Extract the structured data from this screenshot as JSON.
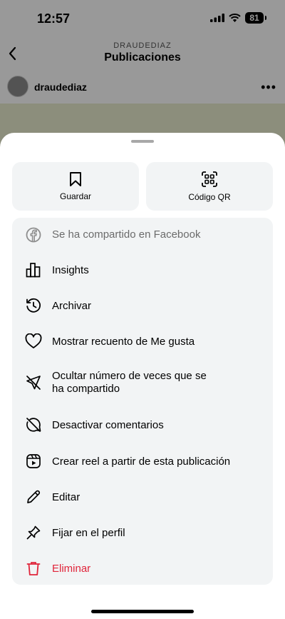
{
  "status_bar": {
    "time": "12:57",
    "battery": "81"
  },
  "nav": {
    "subtitle": "DRAUDEDIAZ",
    "title": "Publicaciones"
  },
  "post": {
    "username": "draudediaz"
  },
  "sheet": {
    "top_actions": [
      {
        "label": "Guardar",
        "icon": "bookmark-icon"
      },
      {
        "label": "Código QR",
        "icon": "qr-code-icon"
      }
    ],
    "menu": [
      {
        "label": "Se ha compartido en Facebook",
        "icon": "facebook-icon"
      },
      {
        "label": "Insights",
        "icon": "bar-chart-icon"
      },
      {
        "label": "Archivar",
        "icon": "archive-history-icon"
      },
      {
        "label": "Mostrar recuento de Me gusta",
        "icon": "heart-icon"
      },
      {
        "label_line1": "Ocultar número de veces que se",
        "label_line2": "ha compartido",
        "icon": "send-off-icon"
      },
      {
        "label": "Desactivar comentarios",
        "icon": "comment-off-icon"
      },
      {
        "label": "Crear reel a partir de esta publicación",
        "icon": "reel-icon"
      },
      {
        "label": "Editar",
        "icon": "pencil-icon"
      },
      {
        "label": "Fijar en el perfil",
        "icon": "pin-icon"
      },
      {
        "label": "Eliminar",
        "icon": "trash-icon"
      }
    ]
  },
  "colors": {
    "danger": "#e0243a",
    "sheet_bg": "#ffffff",
    "card_bg": "#f2f4f5"
  }
}
